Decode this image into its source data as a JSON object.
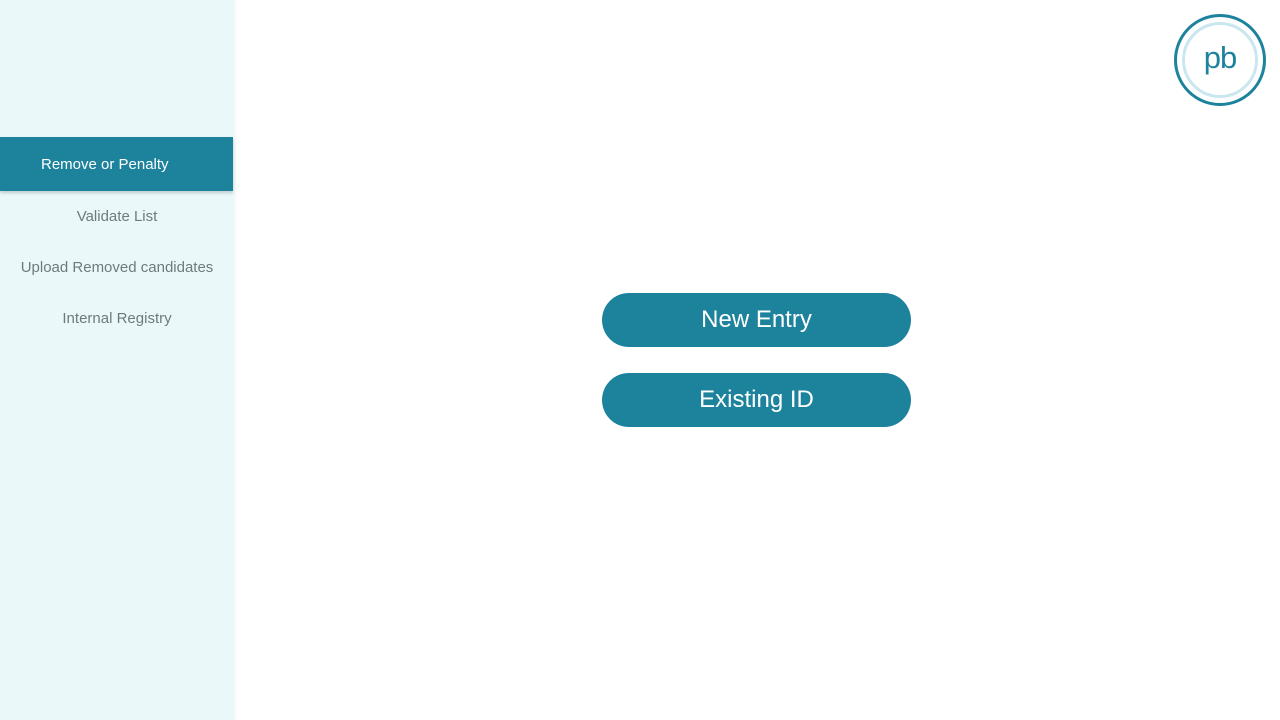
{
  "sidebar": {
    "items": [
      {
        "label": "Remove or Penalty",
        "active": true
      },
      {
        "label": "Validate List",
        "active": false
      },
      {
        "label": "Upload Removed candidates",
        "active": false
      },
      {
        "label": "Internal Registry",
        "active": false
      }
    ]
  },
  "logo": {
    "text": "pb",
    "icon": "pb-logo-icon"
  },
  "main": {
    "new_entry_label": "New Entry",
    "existing_id_label": "Existing ID"
  },
  "colors": {
    "accent": "#1d839c",
    "sidebar_bg": "#eaf8f9",
    "nav_text": "#6f7a7d"
  }
}
